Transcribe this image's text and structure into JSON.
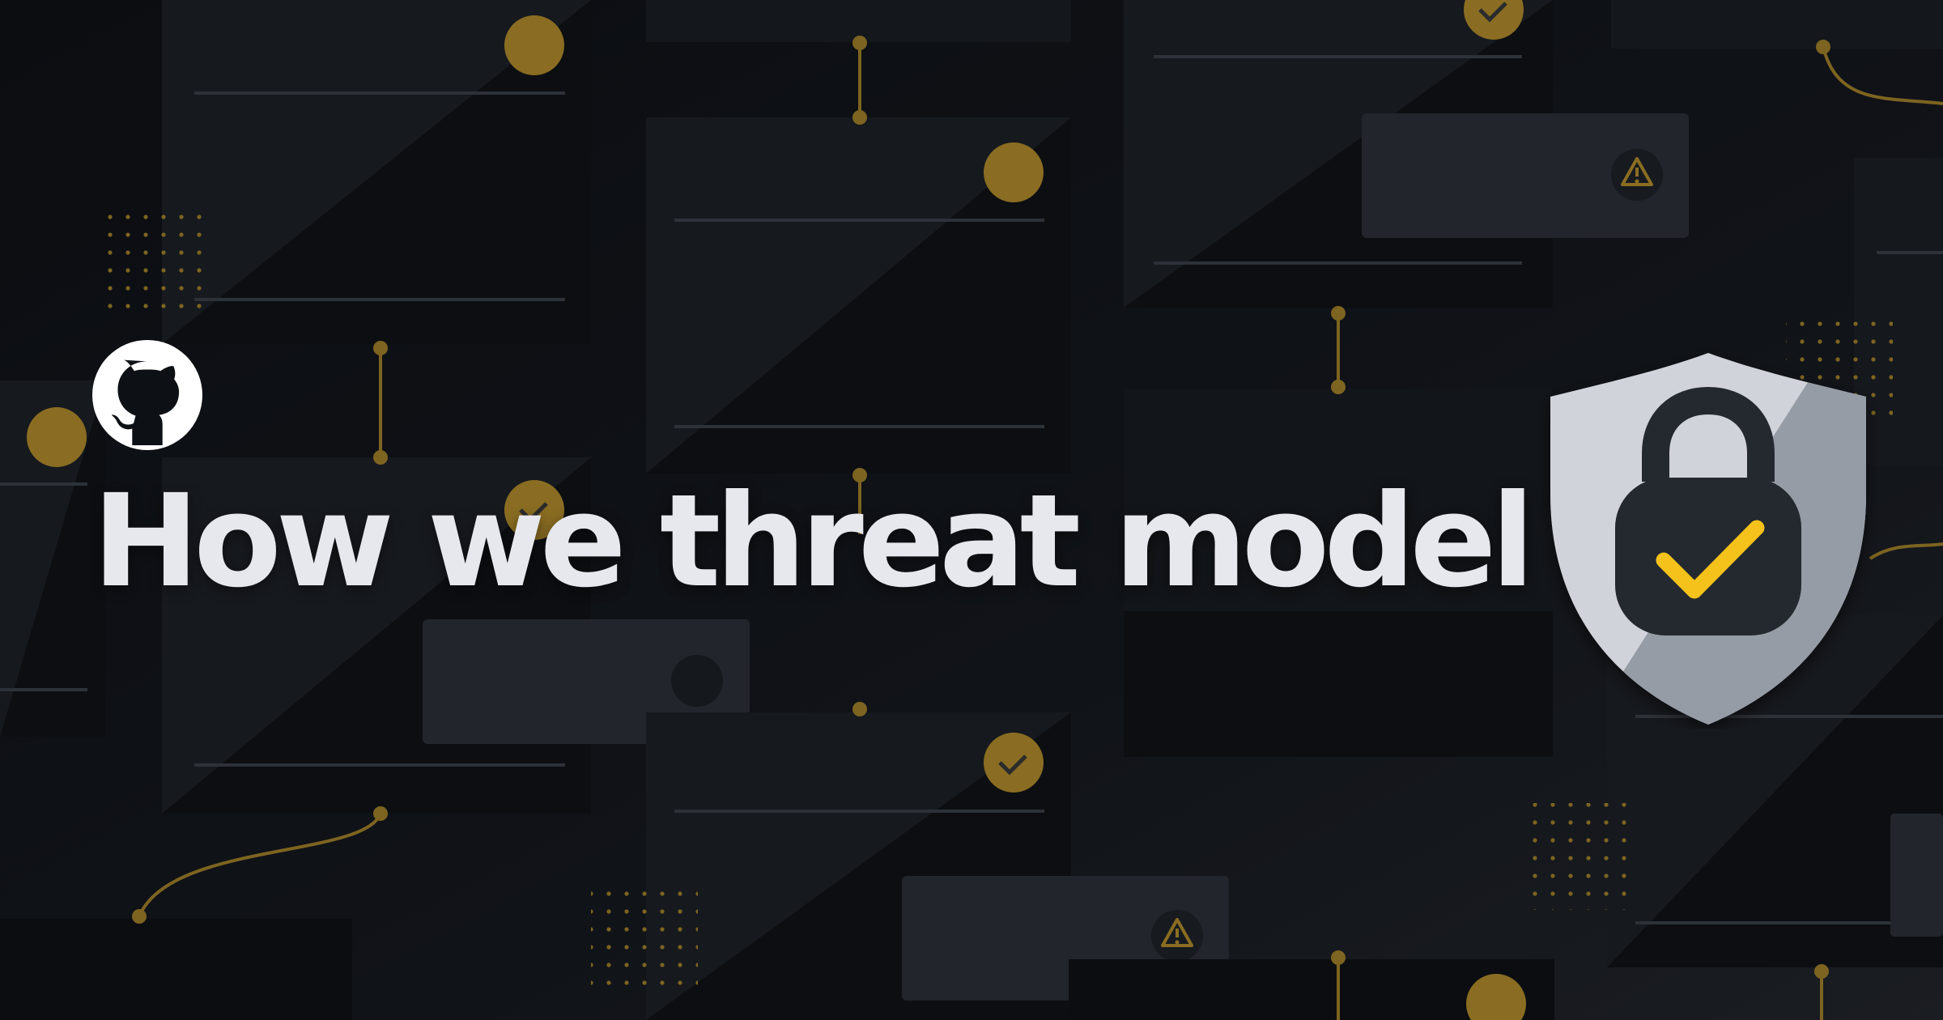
{
  "page": {
    "title": "How we threat model"
  },
  "brand": {
    "logo_icon": "github-octocat-icon"
  },
  "illustration": {
    "shield_icon": "shield-icon",
    "lock_icon": "padlock-icon",
    "check_icon": "checkmark-icon",
    "warning_icon": "warning-triangle-icon"
  },
  "colors": {
    "background": "#0d1014",
    "card": "#16191e",
    "gold": "#8a6d22",
    "gold_line": "#9a7a2a",
    "title": "#e6e8ee",
    "shield_light": "#d0d3d9",
    "shield_dark": "#969ca5",
    "lock_body": "#24282f",
    "check": "#f4c21a"
  }
}
